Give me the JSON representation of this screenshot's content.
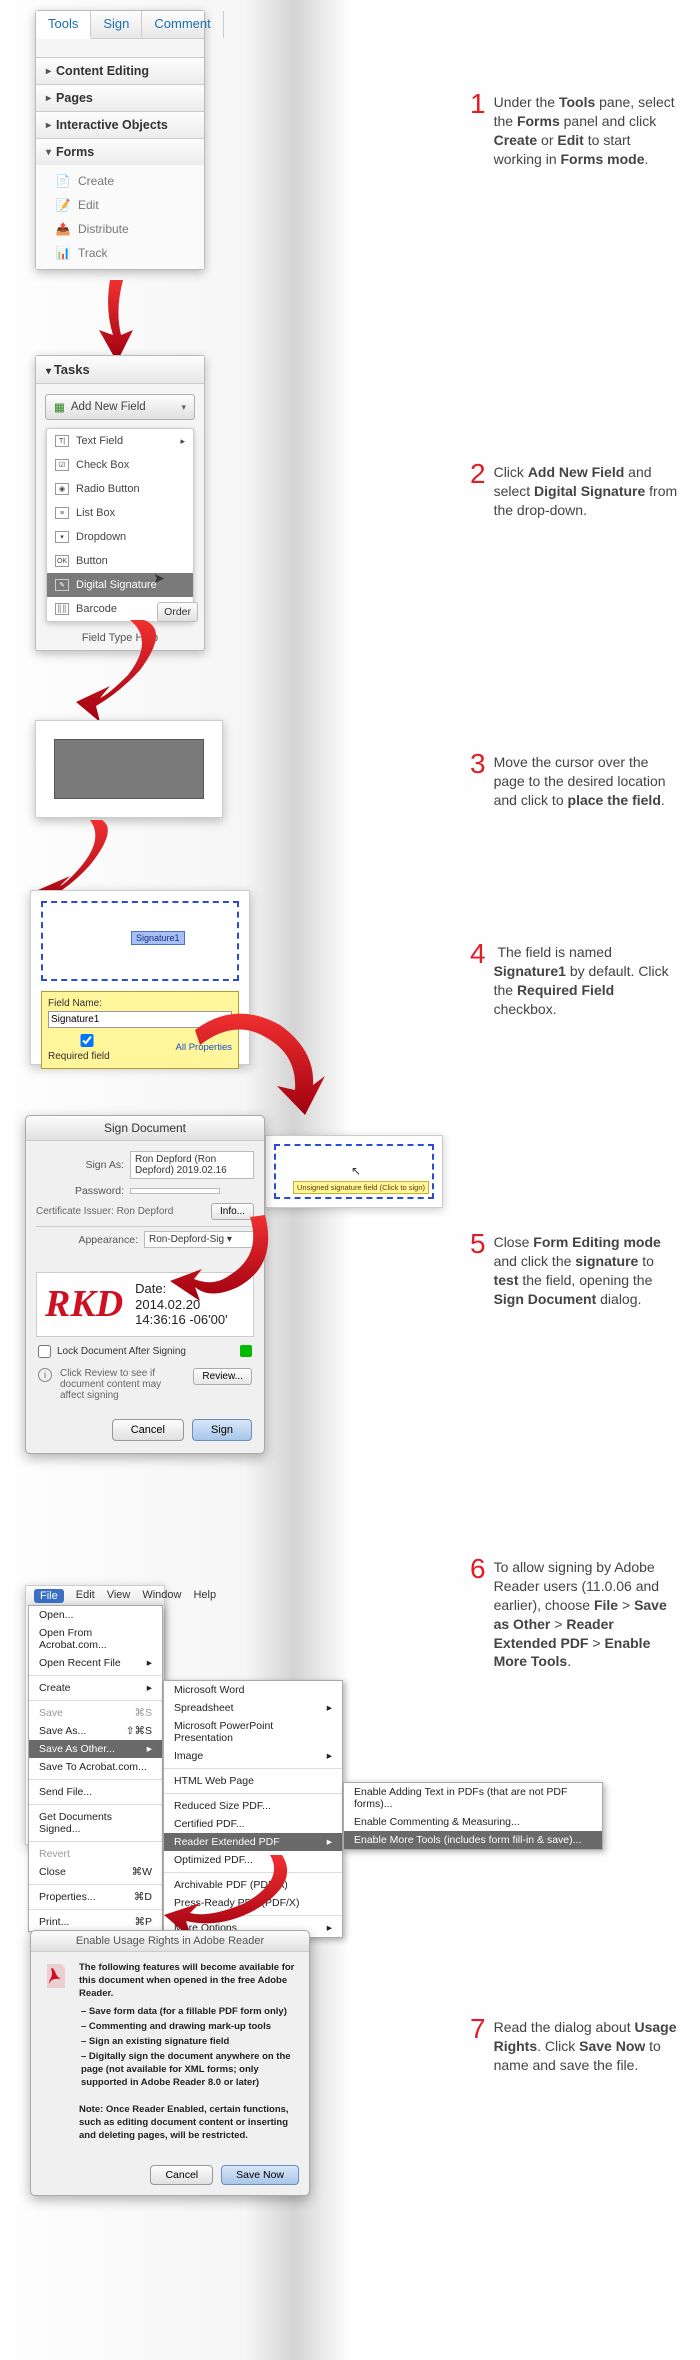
{
  "step1": {
    "text": "Under the <b>Tools</b> pane, select the <b>Forms</b> panel and click <b>Create</b> or <b>Edit</b> to start working in <b>Forms mode</b>."
  },
  "step2": {
    "text": "Click <b>Add New Field</b> and select <b>Digital Signature</b> from the drop-down."
  },
  "step3": {
    "text": "Move the cursor over the page to the desired location and click to <b>place the field</b>."
  },
  "step4": {
    "text": "&nbsp;The field is named <b>Signature1</b> by default. Click the <b>Required Field</b> checkbox."
  },
  "step5": {
    "text": "Close <b>Form Editing mode</b> and click the <b>signature</b> to <b>test</b> the field, opening the <b>Sign Document</b> dialog."
  },
  "step6": {
    "text": "To allow signing by Adobe Reader users (11.0.06 and earlier), choose <b>File</b> > <b>Save as Other</b> > <b>Reader Extended PDF</b> > <b>Enable More Tools</b>."
  },
  "step7": {
    "text": "Read the dialog about <b>Usage Rights</b>. Click <b>Save Now</b> to name and save the file."
  },
  "tabs": {
    "tools": "Tools",
    "sign": "Sign",
    "comment": "Comment"
  },
  "acc": {
    "content": "Content Editing",
    "pages": "Pages",
    "interactive": "Interactive Objects",
    "forms": "Forms"
  },
  "forms_items": {
    "create": "Create",
    "edit": "Edit",
    "distribute": "Distribute",
    "track": "Track"
  },
  "tasks": {
    "header": "Tasks",
    "add": "Add New Field",
    "order": "Order",
    "help": "Field Type Help",
    "items": {
      "text": "Text Field",
      "check": "Check Box",
      "radio": "Radio Button",
      "list": "List Box",
      "drop": "Dropdown",
      "button": "Button",
      "digsig": "Digital Signature",
      "barcode": "Barcode"
    }
  },
  "sigfield": {
    "label": "Signature1",
    "fname": "Field Name:",
    "val": "Signature1",
    "req": "Required field",
    "allprops": "All Properties"
  },
  "signdlg": {
    "title": "Sign Document",
    "signas": "Sign As:",
    "signas_val": "Ron Depford (Ron Depford) 2019.02.16",
    "password": "Password:",
    "issuer": "Certificate Issuer: Ron Depford",
    "info": "Info...",
    "appearance": "Appearance:",
    "app_val": "Ron-Depford-Sig",
    "rkd": "RKD",
    "date_lbl": "Date:",
    "date1": "2014.02.20",
    "date2": "14:36:16 -06'00'",
    "lock": "Lock Document After Signing",
    "review": "Click Review to see if document content may affect signing",
    "review_btn": "Review...",
    "cancel": "Cancel",
    "sign": "Sign"
  },
  "unsigned": "Unsigned signature field (Click to sign)",
  "menus": {
    "top": {
      "file": "File",
      "edit": "Edit",
      "view": "View",
      "window": "Window",
      "help": "Help"
    },
    "file": {
      "open": "Open...",
      "openacro": "Open From Acrobat.com...",
      "openrecent": "Open Recent File",
      "create": "Create",
      "save": "Save",
      "saveas": "Save As...",
      "saveother": "Save As Other...",
      "saveacro": "Save To Acrobat.com...",
      "sendfile": "Send File...",
      "getdocs": "Get Documents Signed...",
      "revert": "Revert",
      "close": "Close",
      "props": "Properties...",
      "print": "Print...",
      "k_save": "⌘S",
      "k_saveas": "⇧⌘S",
      "k_close": "⌘W",
      "k_props": "⌘D",
      "k_print": "⌘P"
    },
    "other": {
      "word": "Microsoft Word",
      "spread": "Spreadsheet",
      "ppt": "Microsoft PowerPoint Presentation",
      "image": "Image",
      "html": "HTML Web Page",
      "reduced": "Reduced Size PDF...",
      "cert": "Certified PDF...",
      "reader": "Reader Extended PDF",
      "opt": "Optimized PDF...",
      "arch": "Archivable PDF (PDF/A)",
      "press": "Press-Ready PDF (PDF/X)",
      "more": "More Options"
    },
    "reader": {
      "addtext": "Enable Adding Text in PDFs (that are not PDF forms)...",
      "comment": "Enable Commenting & Measuring...",
      "more": "Enable More Tools (includes form fill-in & save)..."
    }
  },
  "usage": {
    "title": "Enable Usage Rights in Adobe Reader",
    "intro": "The following features will become available for this document when opened in the free Adobe Reader.",
    "b1": "– Save form data (for a fillable PDF form only)",
    "b2": "– Commenting and drawing mark-up tools",
    "b3": "– Sign an existing signature field",
    "b4": "– Digitally sign the document anywhere on the page (not available for XML forms; only supported in Adobe Reader 8.0 or later)",
    "note": "Note: Once Reader Enabled, certain functions, such as editing document content or inserting and deleting pages, will be restricted.",
    "cancel": "Cancel",
    "save": "Save Now"
  }
}
